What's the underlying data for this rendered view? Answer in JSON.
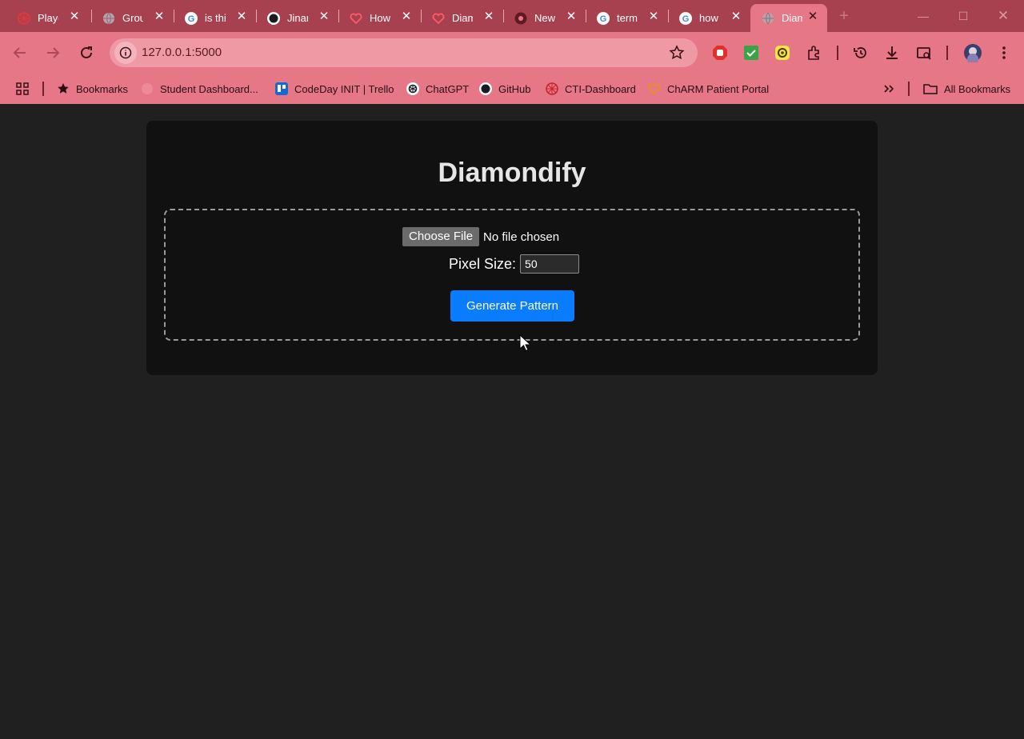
{
  "browser": {
    "tabs": [
      {
        "label": "Playground",
        "icon": "globe-red-icon",
        "active": false
      },
      {
        "label": "Group",
        "icon": "globe-gray-icon",
        "active": false
      },
      {
        "label": "is this",
        "icon": "google-icon",
        "active": false
      },
      {
        "label": "Jinari",
        "icon": "github-icon",
        "active": false
      },
      {
        "label": "How",
        "icon": "heart-icon",
        "active": false
      },
      {
        "label": "Diamond",
        "icon": "heart-icon",
        "active": false
      },
      {
        "label": "New",
        "icon": "chrome-icon",
        "active": false
      },
      {
        "label": "term",
        "icon": "google-icon",
        "active": false
      },
      {
        "label": "how",
        "icon": "google-icon",
        "active": false
      },
      {
        "label": "Diamondify",
        "icon": "globe-gray-icon",
        "active": true
      }
    ],
    "url": "127.0.0.1:5000",
    "bookmarks": [
      {
        "label": "Bookmarks",
        "icon": "star-icon"
      },
      {
        "label": "Student Dashboard...",
        "icon": "student-dashboard-icon"
      },
      {
        "label": "CodeDay INIT | Trello",
        "icon": "trello-icon"
      },
      {
        "label": "ChatGPT",
        "icon": "chatgpt-icon"
      },
      {
        "label": "GitHub",
        "icon": "github-icon"
      },
      {
        "label": "CTI-Dashboard",
        "icon": "cti-icon"
      },
      {
        "label": "ChARM Patient Portal",
        "icon": "heart-icon"
      }
    ],
    "all_bookmarks": "All Bookmarks",
    "colors": {
      "tabstrip": "#a8414f",
      "toolbar": "#e67786"
    }
  },
  "app": {
    "title": "Diamondify",
    "choose_file": "Choose File",
    "no_file": "No file chosen",
    "pixel_label": "Pixel Size:",
    "pixel_value": "50",
    "generate": "Generate Pattern",
    "colors": {
      "card": "#111111",
      "page": "#202020",
      "button": "#0a7cff"
    }
  }
}
